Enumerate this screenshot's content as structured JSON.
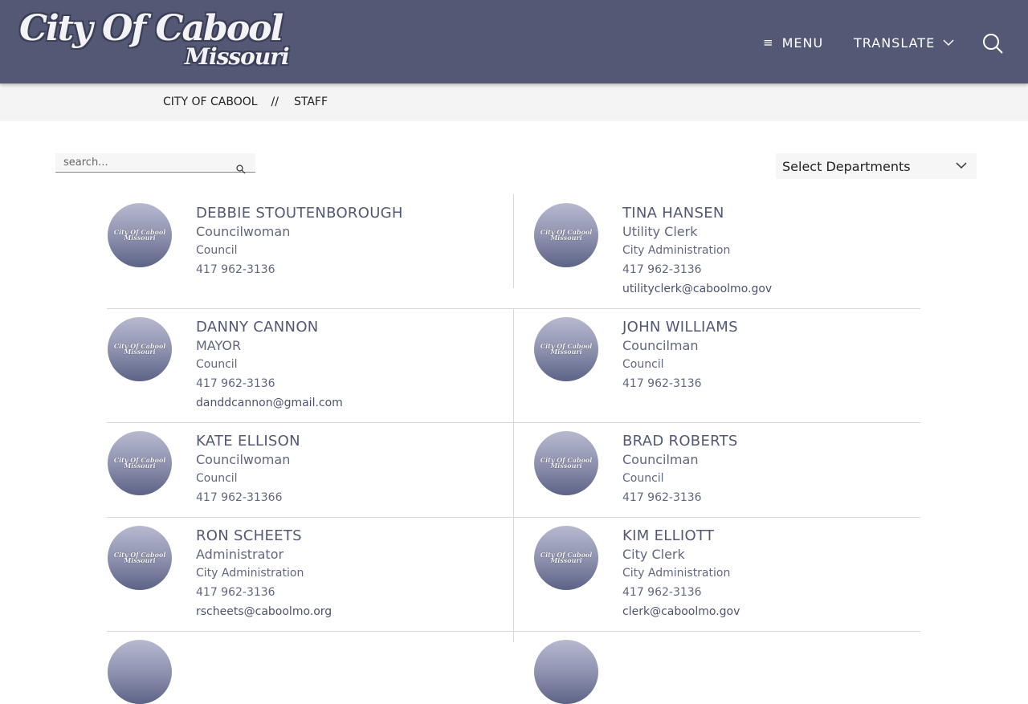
{
  "header": {
    "logo_line1": "City Of Cabool",
    "logo_line2": "Missouri",
    "menu_label": "MENU",
    "translate_label": "TRANSLATE"
  },
  "breadcrumb": {
    "home": "CITY OF CABOOL",
    "separator": "//",
    "current": "STAFF"
  },
  "search": {
    "placeholder": "search..."
  },
  "departments": {
    "selected": "Select Departments"
  },
  "avatar_text": {
    "line1": "City Of Cabool",
    "line2": "Missouri"
  },
  "staff": [
    {
      "name": "DEBBIE STOUTENBOROUGH",
      "title": "Councilwoman",
      "dept": "Council",
      "phone": "417 962-3136",
      "email": ""
    },
    {
      "name": "TINA HANSEN",
      "title": "Utility Clerk",
      "dept": "City Administration",
      "phone": "417 962-3136",
      "email": "utilityclerk@caboolmo.gov"
    },
    {
      "name": "DANNY CANNON",
      "title": "MAYOR",
      "dept": "Council",
      "phone": "417 962-3136",
      "email": "danddcannon@gmail.com"
    },
    {
      "name": "JOHN WILLIAMS",
      "title": "Councilman",
      "dept": "Council",
      "phone": "417 962-3136",
      "email": ""
    },
    {
      "name": "KATE ELLISON",
      "title": "Councilwoman",
      "dept": "Council",
      "phone": "417 962-31366",
      "email": ""
    },
    {
      "name": "BRAD ROBERTS",
      "title": "Councilman",
      "dept": "Council",
      "phone": "417 962-3136",
      "email": ""
    },
    {
      "name": "RON SCHEETS",
      "title": "Administrator",
      "dept": "City Administration",
      "phone": "417 962-3136",
      "email": "rscheets@caboolmo.org"
    },
    {
      "name": "KIM ELLIOTT",
      "title": "City Clerk",
      "dept": "City Administration",
      "phone": "417 962-3136",
      "email": "clerk@caboolmo.gov"
    }
  ]
}
